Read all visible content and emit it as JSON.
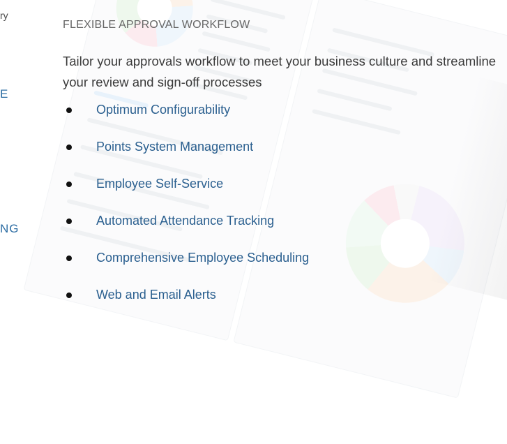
{
  "left_column": {
    "text_fragment": "ry",
    "heading_fragment_1": "E",
    "heading_fragment_2": "NG"
  },
  "section": {
    "title": "FLEXIBLE APPROVAL WORKFLOW",
    "description": "Tailor your approvals workflow to meet your business culture and streamline your review and sign-off processes"
  },
  "features": [
    {
      "label": "Optimum Configurability"
    },
    {
      "label": "Points System Management"
    },
    {
      "label": "Employee Self-Service"
    },
    {
      "label": "Automated Attendance Tracking"
    },
    {
      "label": "Comprehensive Employee Scheduling"
    },
    {
      "label": "Web and Email Alerts"
    }
  ],
  "colors": {
    "heading_blue": "#2d6da3",
    "feature_blue": "#2a5f8f",
    "title_gray": "#666666",
    "body_text": "#3a3a3a"
  }
}
